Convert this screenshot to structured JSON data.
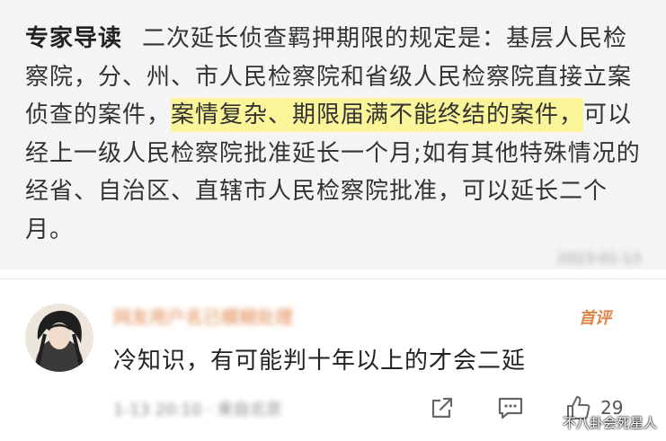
{
  "article": {
    "label": "专家导读",
    "text_before": "二次延长侦查羁押期限的规定是：基层人民检察院，分、州、市人民检察院和省级人民检察院直接立案侦查的案件，",
    "text_highlight": "案情复杂、期限届满不能终结的案件，",
    "text_after": "可以经上一级人民检察院批准延长一个月;如有其他特殊情况的经省、自治区、直辖市人民检察院批准，可以延长二个月。",
    "meta_blurred": "2023-01-13"
  },
  "comment": {
    "username_blurred": "网友用户名已模糊处理",
    "badge": "首评",
    "text": "冷知识，有可能判十年以上的才会二延",
    "meta_blurred": "1-13 20:10 · 来自北京",
    "like_count": "29",
    "icons": {
      "share": "share-icon",
      "reply": "reply-icon",
      "like": "thumbs-up-icon"
    }
  },
  "watermark": "不八卦会死星人"
}
